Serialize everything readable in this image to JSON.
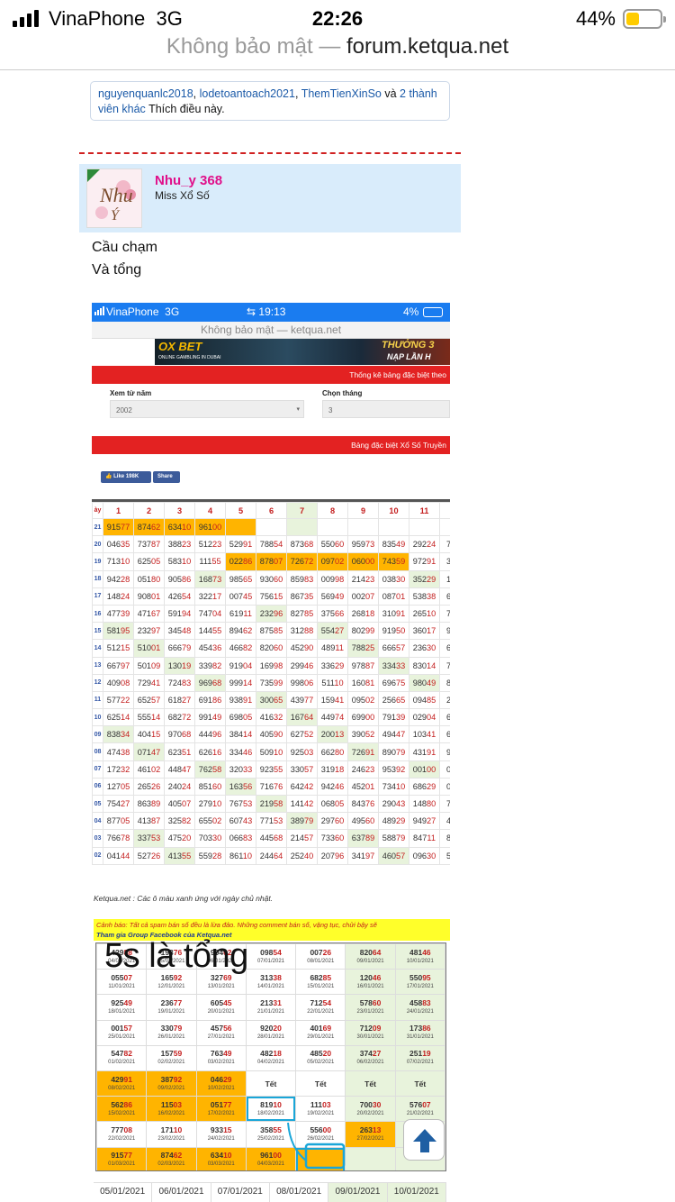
{
  "status_bar": {
    "carrier": "VinaPhone",
    "network": "3G",
    "time": "22:26",
    "battery": "44%"
  },
  "url_bar": {
    "prefix": "Không bảo mật —",
    "domain": "forum.ketqua.net"
  },
  "likes": {
    "users": [
      "nguyenquanlc2018",
      "lodetoantoach2021",
      "ThemTienXinSo"
    ],
    "connector": "và",
    "others": "2 thành viên khác",
    "suffix": "Thích điều này."
  },
  "post": {
    "username": "Nhu_y 368",
    "user_title": "Miss Xổ Số",
    "line1": "Cầu chạm",
    "line2": "Và tổng"
  },
  "inner": {
    "carrier": "VinaPhone",
    "network": "3G",
    "time": "19:13",
    "battery": "4%",
    "url": "Không bảo mật — ketqua.net",
    "banner_left": "OX BET",
    "banner_sub": "ONLINE GAMBLING IN DUBAI",
    "banner_right": "THƯỞNG 3",
    "banner_right2": "NẠP LẦN H",
    "red1": "Thống kê bảng đặc biệt theo",
    "label_year": "Xem từ năm",
    "year_value": "2002",
    "label_month": "Chọn tháng",
    "month_value": "3",
    "red2": "Bảng đặc biệt Xổ Số Truyền",
    "fb_like": "Like 198K",
    "fb_share": "Share",
    "note": "Ketqua.net : Các ô màu xanh ứng với ngày chủ nhật.",
    "warning": "Cảnh báo: Tất cả spam bán số đều là lừa đảo. Những comment bán số, vặng tục, chửi bậy sẽ",
    "warning2": "Tham gia Group Facebook của Ketqua.net",
    "overlay_text": "5s là tổng"
  },
  "grid": {
    "header_first": "ày",
    "headers": [
      "1",
      "2",
      "3",
      "4",
      "5",
      "6",
      "7",
      "8",
      "9",
      "10",
      "11",
      ""
    ],
    "rows": [
      {
        "label": "21",
        "cells": [
          "91577",
          "87462",
          "63410",
          "96100",
          "",
          "",
          "",
          "",
          "",
          "",
          "",
          ""
        ]
      },
      {
        "label": "20",
        "cells": [
          "04635",
          "73787",
          "38823",
          "51223",
          "52991",
          "78854",
          "87368",
          "55060",
          "95973",
          "83549",
          "29224",
          "7"
        ]
      },
      {
        "label": "19",
        "cells": [
          "71310",
          "62505",
          "58310",
          "11155",
          "02286",
          "87807",
          "72672",
          "09702",
          "06000",
          "74359",
          "97291",
          "3"
        ]
      },
      {
        "label": "18",
        "cells": [
          "94228",
          "05180",
          "90586",
          "16873",
          "98565",
          "93060",
          "85983",
          "00998",
          "21423",
          "03830",
          "35229",
          "1"
        ]
      },
      {
        "label": "17",
        "cells": [
          "14824",
          "90801",
          "42654",
          "32217",
          "00745",
          "75615",
          "86735",
          "56949",
          "00207",
          "08701",
          "53838",
          "6"
        ]
      },
      {
        "label": "16",
        "cells": [
          "47739",
          "47167",
          "59194",
          "74704",
          "61911",
          "23296",
          "82785",
          "37566",
          "26818",
          "31091",
          "26510",
          "7"
        ]
      },
      {
        "label": "15",
        "cells": [
          "58195",
          "23297",
          "34548",
          "14455",
          "89462",
          "87585",
          "31288",
          "55427",
          "80299",
          "91950",
          "36017",
          "9"
        ]
      },
      {
        "label": "14",
        "cells": [
          "51215",
          "51001",
          "66679",
          "45436",
          "46682",
          "82060",
          "45290",
          "48911",
          "78825",
          "66657",
          "23630",
          "6"
        ]
      },
      {
        "label": "13",
        "cells": [
          "66797",
          "50109",
          "13019",
          "33982",
          "91904",
          "16998",
          "29946",
          "33629",
          "97887",
          "33433",
          "83014",
          "7"
        ]
      },
      {
        "label": "12",
        "cells": [
          "40908",
          "72941",
          "72483",
          "96968",
          "99914",
          "73599",
          "99806",
          "51110",
          "16081",
          "69675",
          "98049",
          "8"
        ]
      },
      {
        "label": "11",
        "cells": [
          "57722",
          "65257",
          "61827",
          "69186",
          "93891",
          "30065",
          "43977",
          "15941",
          "09502",
          "25665",
          "09485",
          "2"
        ]
      },
      {
        "label": "10",
        "cells": [
          "62514",
          "55514",
          "68272",
          "99149",
          "69805",
          "41632",
          "16764",
          "44974",
          "69900",
          "79139",
          "02904",
          "6"
        ]
      },
      {
        "label": "09",
        "cells": [
          "83834",
          "40415",
          "97068",
          "44496",
          "38414",
          "40590",
          "62752",
          "20013",
          "39052",
          "49447",
          "10341",
          "6"
        ]
      },
      {
        "label": "08",
        "cells": [
          "47438",
          "07147",
          "62351",
          "62616",
          "33446",
          "50910",
          "92503",
          "66280",
          "72691",
          "89079",
          "43191",
          "9"
        ]
      },
      {
        "label": "07",
        "cells": [
          "17232",
          "46102",
          "44847",
          "76258",
          "32033",
          "92355",
          "33057",
          "31918",
          "24623",
          "95392",
          "00100",
          "0"
        ]
      },
      {
        "label": "06",
        "cells": [
          "12705",
          "26526",
          "24024",
          "85160",
          "16356",
          "71676",
          "64242",
          "94246",
          "45201",
          "73410",
          "68629",
          "0"
        ]
      },
      {
        "label": "05",
        "cells": [
          "75427",
          "86389",
          "40507",
          "27910",
          "76753",
          "21958",
          "14142",
          "06805",
          "84376",
          "29043",
          "14880",
          "7"
        ]
      },
      {
        "label": "04",
        "cells": [
          "87705",
          "41387",
          "32582",
          "65502",
          "60743",
          "77153",
          "38979",
          "29760",
          "49560",
          "48929",
          "94927",
          "4"
        ]
      },
      {
        "label": "03",
        "cells": [
          "76678",
          "33753",
          "47520",
          "70330",
          "06683",
          "44568",
          "21457",
          "73360",
          "63789",
          "58879",
          "84711",
          "8"
        ]
      },
      {
        "label": "02",
        "cells": [
          "04144",
          "52726",
          "41355",
          "55928",
          "86110",
          "24464",
          "25240",
          "20796",
          "34197",
          "46057",
          "09630",
          "5"
        ]
      }
    ]
  },
  "calendar": {
    "rows": [
      [
        {
          "n": "42988",
          "d": "04/01/2021"
        },
        {
          "n": "19376",
          "d": "05/01/2021"
        },
        {
          "n": "90402",
          "d": "06/01/2021"
        },
        {
          "n": "09854",
          "d": "07/01/2021"
        },
        {
          "n": "00726",
          "d": "08/01/2021"
        },
        {
          "n": "82064",
          "d": "09/01/2021"
        },
        {
          "n": "48146",
          "d": "10/01/2021"
        }
      ],
      [
        {
          "n": "05507",
          "d": "11/01/2021"
        },
        {
          "n": "16592",
          "d": "12/01/2021"
        },
        {
          "n": "32769",
          "d": "13/01/2021"
        },
        {
          "n": "31338",
          "d": "14/01/2021"
        },
        {
          "n": "68285",
          "d": "15/01/2021"
        },
        {
          "n": "12046",
          "d": "16/01/2021"
        },
        {
          "n": "55095",
          "d": "17/01/2021"
        }
      ],
      [
        {
          "n": "92549",
          "d": "18/01/2021"
        },
        {
          "n": "23677",
          "d": "19/01/2021"
        },
        {
          "n": "60545",
          "d": "20/01/2021"
        },
        {
          "n": "21331",
          "d": "21/01/2021"
        },
        {
          "n": "71254",
          "d": "22/01/2021"
        },
        {
          "n": "57860",
          "d": "23/01/2021"
        },
        {
          "n": "45883",
          "d": "24/01/2021"
        }
      ],
      [
        {
          "n": "00157",
          "d": "25/01/2021"
        },
        {
          "n": "33079",
          "d": "26/01/2021"
        },
        {
          "n": "45756",
          "d": "27/01/2021"
        },
        {
          "n": "92020",
          "d": "28/01/2021"
        },
        {
          "n": "40169",
          "d": "29/01/2021"
        },
        {
          "n": "71209",
          "d": "30/01/2021"
        },
        {
          "n": "17386",
          "d": "31/01/2021"
        }
      ],
      [
        {
          "n": "54782",
          "d": "01/02/2021"
        },
        {
          "n": "15759",
          "d": "02/02/2021"
        },
        {
          "n": "76349",
          "d": "03/02/2021"
        },
        {
          "n": "48218",
          "d": "04/02/2021"
        },
        {
          "n": "48520",
          "d": "05/02/2021"
        },
        {
          "n": "37427",
          "d": "06/02/2021"
        },
        {
          "n": "25119",
          "d": "07/02/2021"
        }
      ],
      [
        {
          "n": "42991",
          "d": "08/02/2021"
        },
        {
          "n": "38792",
          "d": "09/02/2021"
        },
        {
          "n": "04629",
          "d": "10/02/2021"
        },
        {
          "n": "Tết",
          "d": ""
        },
        {
          "n": "Tết",
          "d": ""
        },
        {
          "n": "Tết",
          "d": ""
        },
        {
          "n": "Tết",
          "d": ""
        }
      ],
      [
        {
          "n": "56286",
          "d": "15/02/2021"
        },
        {
          "n": "11503",
          "d": "16/02/2021"
        },
        {
          "n": "05177",
          "d": "17/02/2021"
        },
        {
          "n": "81910",
          "d": "18/02/2021"
        },
        {
          "n": "11103",
          "d": "19/02/2021"
        },
        {
          "n": "70030",
          "d": "20/02/2021"
        },
        {
          "n": "57607",
          "d": "21/02/2021"
        }
      ],
      [
        {
          "n": "77708",
          "d": "22/02/2021"
        },
        {
          "n": "17110",
          "d": "23/02/2021"
        },
        {
          "n": "93315",
          "d": "24/02/2021"
        },
        {
          "n": "35855",
          "d": "25/02/2021"
        },
        {
          "n": "55600",
          "d": "26/02/2021"
        },
        {
          "n": "26313",
          "d": "27/02/2021"
        },
        {
          "n": "",
          "d": ""
        }
      ],
      [
        {
          "n": "91577",
          "d": "01/03/2021"
        },
        {
          "n": "87462",
          "d": "02/03/2021"
        },
        {
          "n": "63410",
          "d": "03/03/2021"
        },
        {
          "n": "96100",
          "d": "04/03/2021"
        },
        {
          "n": "",
          "d": ""
        },
        {
          "n": "",
          "d": ""
        },
        {
          "n": "",
          "d": ""
        }
      ]
    ]
  },
  "bottom_dates": [
    "05/01/2021",
    "06/01/2021",
    "07/01/2021",
    "08/01/2021",
    "09/01/2021",
    "10/01/2021"
  ],
  "colors": {
    "accent_red": "#e32222",
    "highlight_orange": "#ffb400",
    "sunday_green": "#e8f3dc",
    "username_pink": "#e0108a",
    "inner_status_blue": "#1a7cf0"
  }
}
